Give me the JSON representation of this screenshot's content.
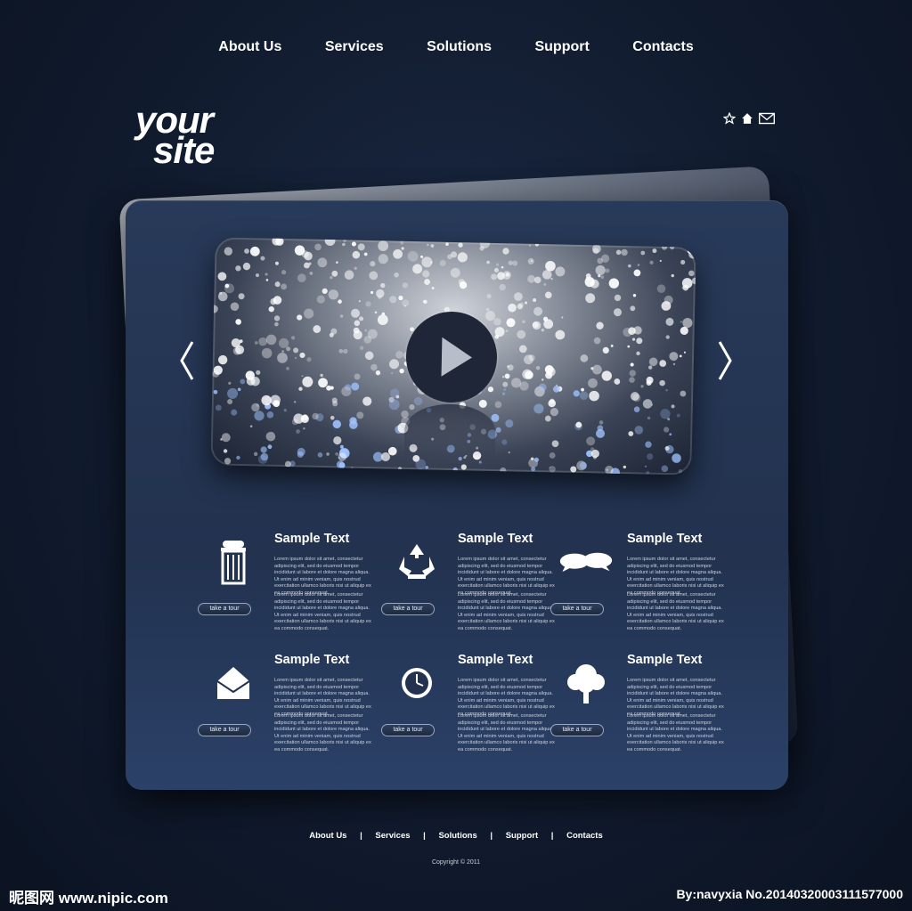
{
  "nav": {
    "items": [
      "About Us",
      "Services",
      "Solutions",
      "Support",
      "Contacts"
    ]
  },
  "logo": {
    "line1": "your",
    "line2": "site"
  },
  "quick_icons": [
    "star-icon",
    "home-icon",
    "mail-icon"
  ],
  "slider": {
    "prev_icon": "chevron-left-icon",
    "next_icon": "chevron-right-icon",
    "play_icon": "play-icon"
  },
  "features": [
    {
      "icon": "trash-can-icon",
      "title": "Sample Text",
      "body": "Lorem ipsum dolor sit amet, consectetur adipiscing elit, sed do eiusmod tempor incididunt ut labore et dolore magna aliqua. Ut enim ad minim veniam, quis nostrud exercitation ullamco laboris nisi ut aliquip ex ea commodo consequat.",
      "button": "take a tour"
    },
    {
      "icon": "recycle-icon",
      "title": "Sample Text",
      "body": "Lorem ipsum dolor sit amet, consectetur adipiscing elit, sed do eiusmod tempor incididunt ut labore et dolore magna aliqua. Ut enim ad minim veniam, quis nostrud exercitation ullamco laboris nisi ut aliquip ex ea commodo consequat.",
      "button": "take a tour"
    },
    {
      "icon": "chat-bubbles-icon",
      "title": "Sample Text",
      "body": "Lorem ipsum dolor sit amet, consectetur adipiscing elit, sed do eiusmod tempor incididunt ut labore et dolore magna aliqua. Ut enim ad minim veniam, quis nostrud exercitation ullamco laboris nisi ut aliquip ex ea commodo consequat.",
      "button": "take a tour"
    },
    {
      "icon": "envelope-icon",
      "title": "Sample Text",
      "body": "Lorem ipsum dolor sit amet, consectetur adipiscing elit, sed do eiusmod tempor incididunt ut labore et dolore magna aliqua. Ut enim ad minim veniam, quis nostrud exercitation ullamco laboris nisi ut aliquip ex ea commodo consequat.",
      "button": "take a tour"
    },
    {
      "icon": "clock-icon",
      "title": "Sample Text",
      "body": "Lorem ipsum dolor sit amet, consectetur adipiscing elit, sed do eiusmod tempor incididunt ut labore et dolore magna aliqua. Ut enim ad minim veniam, quis nostrud exercitation ullamco laboris nisi ut aliquip ex ea commodo consequat.",
      "button": "take a tour"
    },
    {
      "icon": "tree-icon",
      "title": "Sample Text",
      "body": "Lorem ipsum dolor sit amet, consectetur adipiscing elit, sed do eiusmod tempor incididunt ut labore et dolore magna aliqua. Ut enim ad minim veniam, quis nostrud exercitation ullamco laboris nisi ut aliquip ex ea commodo consequat.",
      "button": "take a tour"
    }
  ],
  "footer": {
    "items": [
      "About Us",
      "Services",
      "Solutions",
      "Support",
      "Contacts"
    ],
    "separator": "|",
    "copyright": "Copyright © 2011"
  },
  "watermark": {
    "left": "昵图网 www.nipic.com",
    "right": "By:navyxia  No.20140320003111577000"
  },
  "colors": {
    "background": "#111b2e",
    "card": "#22324f",
    "text": "#ffffff"
  }
}
